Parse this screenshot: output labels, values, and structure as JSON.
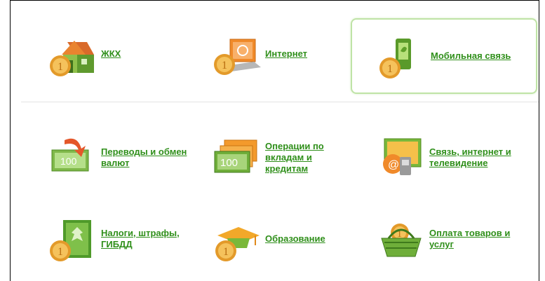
{
  "colors": {
    "link": "#2f8f1a",
    "selected_border": "#bfe3a6",
    "divider": "#e3e3e3"
  },
  "top_row": [
    {
      "label": "ЖКХ",
      "icon": "house-coin-icon",
      "selected": false
    },
    {
      "label": "Интернет",
      "icon": "laptop-coin-icon",
      "selected": false
    },
    {
      "label": "Мобильная связь",
      "icon": "mobile-phone-coin-icon",
      "selected": true
    }
  ],
  "categories": [
    {
      "label": "Переводы и обмен\nвалют",
      "icon": "money-transfer-icon"
    },
    {
      "label": "Операции по\nвкладам и\nкредитам",
      "icon": "banknotes-icon"
    },
    {
      "label": "Связь, интернет и\nтелевидение",
      "icon": "telecom-icon"
    },
    {
      "label": "Налоги, штрафы,\nГИБДД",
      "icon": "tax-eagle-coin-icon"
    },
    {
      "label": "Образование",
      "icon": "graduation-cap-coin-icon"
    },
    {
      "label": "Оплата товаров и\nуслуг",
      "icon": "shopping-basket-coin-icon"
    }
  ]
}
